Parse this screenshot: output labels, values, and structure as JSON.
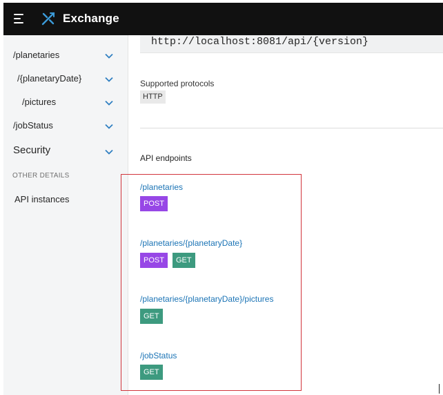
{
  "app": {
    "title": "Exchange"
  },
  "colors": {
    "accent": "#1a73b5",
    "post": "#9747e6",
    "get": "#3d9a7f",
    "highlight": "#d1343b"
  },
  "sidebar": {
    "items": [
      {
        "label": "/planetaries"
      },
      {
        "label": "/{planetaryDate}"
      },
      {
        "label": "/pictures"
      },
      {
        "label": "/jobStatus"
      },
      {
        "label": "Security"
      }
    ],
    "other_header": "OTHER DETAILS",
    "api_instances": "API instances"
  },
  "main": {
    "base_uri": "http://localhost:8081/api/{version}",
    "protocols_label": "Supported protocols",
    "protocol": "HTTP",
    "endpoints_label": "API endpoints",
    "endpoints": [
      {
        "path": "/planetaries",
        "methods": [
          "POST"
        ]
      },
      {
        "path": "/planetaries/{planetaryDate}",
        "methods": [
          "POST",
          "GET"
        ]
      },
      {
        "path": "/planetaries/{planetaryDate}/pictures",
        "methods": [
          "GET"
        ]
      },
      {
        "path": "/jobStatus",
        "methods": [
          "GET"
        ]
      }
    ]
  }
}
